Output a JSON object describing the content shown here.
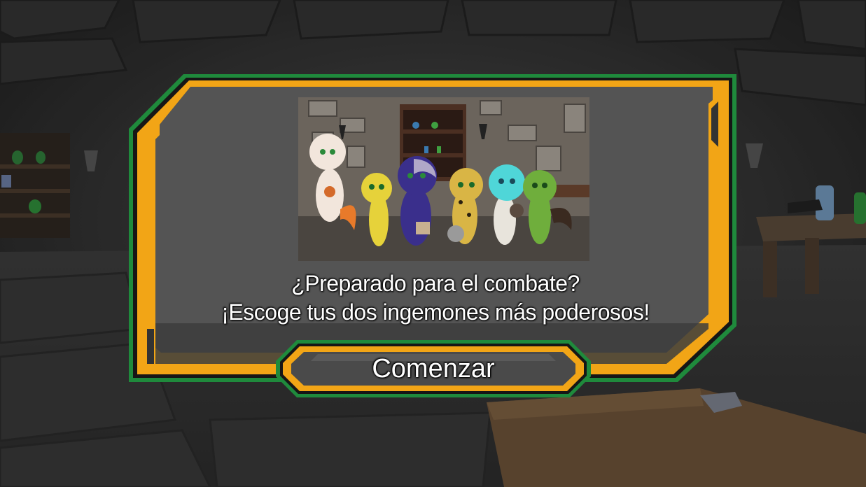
{
  "dialog": {
    "question": "¿Preparado para el combate?",
    "instruction": "¡Escoge tus dos ingemones más poderosos!"
  },
  "start_button": {
    "label": "Comenzar"
  },
  "preview_image": {
    "creatures": [
      {
        "icon": "ingemon-white-orange",
        "color": "#f2e6dc"
      },
      {
        "icon": "ingemon-yellow",
        "color": "#e6d23a"
      },
      {
        "icon": "ingemon-purple",
        "color": "#3a2f8c"
      },
      {
        "icon": "ingemon-leopard",
        "color": "#d9b545"
      },
      {
        "icon": "ingemon-cyan",
        "color": "#4fd6d8"
      },
      {
        "icon": "ingemon-green",
        "color": "#6fae3c"
      }
    ]
  },
  "colors": {
    "frame_orange": "#f2a516",
    "frame_green": "#1f8a3c",
    "panel_grey": "#555555"
  }
}
